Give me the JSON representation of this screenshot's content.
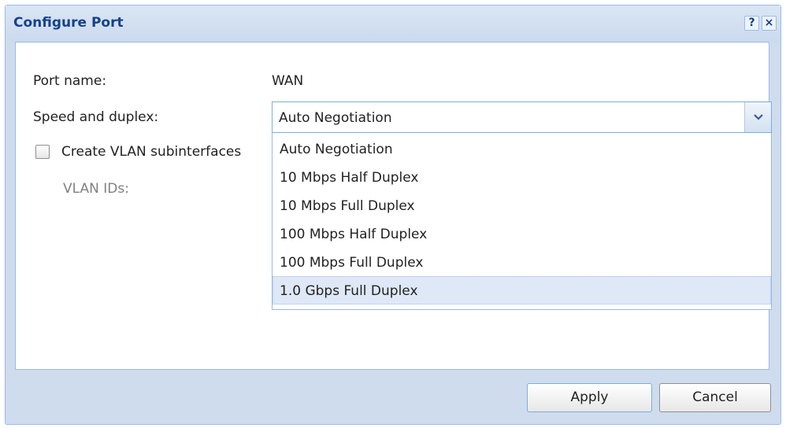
{
  "dialog": {
    "title": "Configure Port",
    "help_icon": "?",
    "close_icon": "×"
  },
  "form": {
    "port_name_label": "Port name:",
    "port_name_value": "WAN",
    "speed_label": "Speed and duplex:",
    "speed_selected": "Auto Negotiation",
    "speed_options": [
      "Auto Negotiation",
      "10 Mbps Half Duplex",
      "10 Mbps Full Duplex",
      "100 Mbps Half Duplex",
      "100 Mbps Full Duplex",
      "1.0 Gbps Full Duplex"
    ],
    "highlighted_option": "1.0 Gbps Full Duplex",
    "vlan_checkbox_label": "Create VLAN subinterfaces",
    "vlan_checkbox_checked": false,
    "vlan_ids_label": "VLAN IDs:"
  },
  "buttons": {
    "apply": "Apply",
    "cancel": "Cancel"
  },
  "colors": {
    "title_text": "#15428b",
    "border": "#99bbe8",
    "highlight": "#dfe8f6"
  }
}
